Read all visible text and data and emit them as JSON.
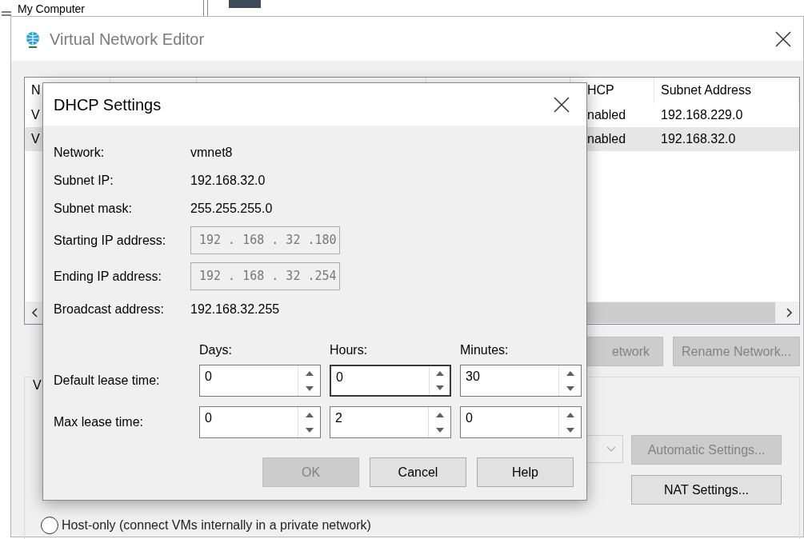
{
  "background_item": {
    "label": "My Computer"
  },
  "window": {
    "title": "Virtual Network Editor"
  },
  "network_table": {
    "columns": [
      {
        "label": "N"
      },
      {
        "label": "HCP"
      },
      {
        "label": "Subnet Address"
      }
    ],
    "rows": [
      {
        "name": "V",
        "dhcp": "nabled",
        "subnet": "192.168.229.0",
        "selected": false
      },
      {
        "name": "V",
        "dhcp": "nabled",
        "subnet": "192.168.32.0",
        "selected": true
      }
    ]
  },
  "network_buttons": [
    {
      "label": "etwork",
      "disabled": true
    },
    {
      "label": "Rename Network...",
      "disabled": true
    }
  ],
  "vmnet_group": {
    "label": "V",
    "nat_dropdown": {
      "disabled": true
    },
    "buttons": [
      {
        "label": "Automatic Settings...",
        "disabled": true
      },
      {
        "label": "NAT Settings...",
        "disabled": false
      }
    ],
    "options": [
      {
        "label": "Host-only (connect VMs internally in a private network)",
        "selected": false
      }
    ]
  },
  "dialog": {
    "title": "DHCP Settings",
    "info": [
      {
        "label": "Network:",
        "value": "vmnet8"
      },
      {
        "label": "Subnet IP:",
        "value": "192.168.32.0"
      },
      {
        "label": "Subnet mask:",
        "value": "255.255.255.0"
      }
    ],
    "ip_fields": [
      {
        "label": "Starting IP address:",
        "value": "192 . 168 . 32 .180",
        "disabled": true
      },
      {
        "label": "Ending IP address:",
        "value": "192 . 168 . 32 .254",
        "disabled": true
      }
    ],
    "broadcast": {
      "label": "Broadcast address:",
      "value": "192.168.32.255"
    },
    "lease": {
      "columns": [
        "Days:",
        "Hours:",
        "Minutes:"
      ],
      "rows": [
        {
          "label": "Default lease time:",
          "fields": [
            {
              "value": "0",
              "focused": false
            },
            {
              "value": "0",
              "focused": true
            },
            {
              "value": "30",
              "focused": false
            }
          ]
        },
        {
          "label": "Max lease time:",
          "fields": [
            {
              "value": "0",
              "focused": false
            },
            {
              "value": "2",
              "focused": false
            },
            {
              "value": "0",
              "focused": false
            }
          ]
        }
      ]
    },
    "buttons": [
      {
        "label": "OK",
        "disabled": true
      },
      {
        "label": "Cancel",
        "disabled": false
      },
      {
        "label": "Help",
        "disabled": false
      }
    ]
  }
}
